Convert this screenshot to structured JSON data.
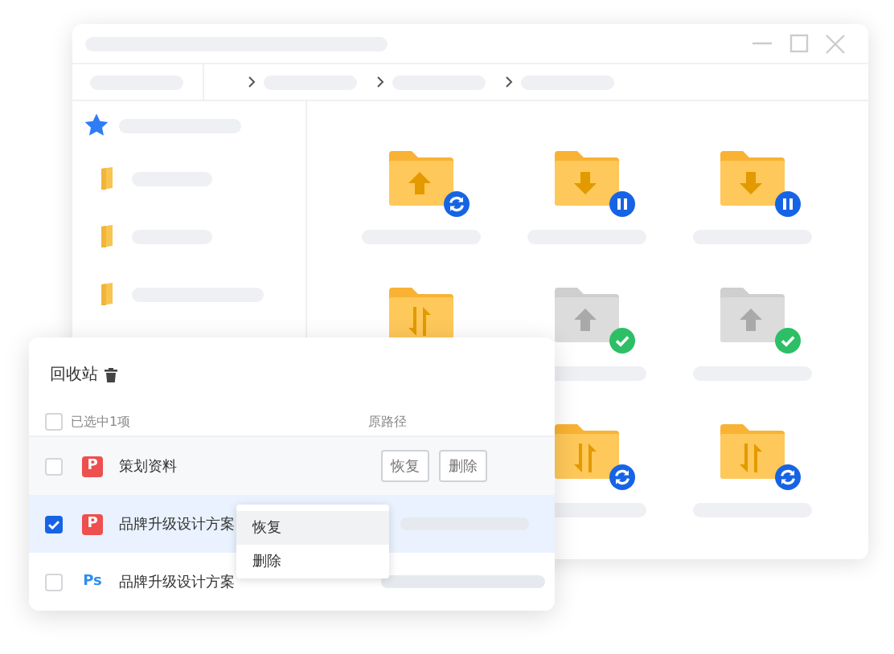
{
  "file_window": {
    "sidebar": {
      "items": [
        {
          "kind": "favorite"
        },
        {
          "kind": "folder"
        },
        {
          "kind": "folder"
        },
        {
          "kind": "folder"
        }
      ]
    },
    "folders": [
      {
        "kind": "upload",
        "badge": {
          "kind": "sync"
        }
      },
      {
        "kind": "download",
        "badge": {
          "kind": "pause"
        }
      },
      {
        "kind": "download",
        "badge": {
          "kind": "pause"
        }
      },
      {
        "kind": "transfer"
      },
      {
        "kind": "upload",
        "badge": {
          "kind": "check"
        }
      },
      {
        "kind": "upload",
        "badge": {
          "kind": "check"
        }
      },
      {
        "kind": "transfer",
        "badge": {
          "kind": "sync"
        }
      },
      {
        "kind": "transfer",
        "badge": {
          "kind": "sync"
        }
      }
    ]
  },
  "recycle_bin": {
    "title": "回收站",
    "header": {
      "checked": false,
      "label": "已选中1项",
      "path_header": "原路径"
    },
    "rows": [
      {
        "kind": "ppt",
        "badge": "P",
        "name": "策划资料",
        "checked": false,
        "selected": false,
        "actions": [
          "恢复",
          "删除"
        ]
      },
      {
        "kind": "ppt",
        "badge": "P",
        "name": "品牌升级设计方案",
        "checked": true,
        "selected": true
      },
      {
        "kind": "psd",
        "badge": "Ps",
        "name": "品牌升级设计方案",
        "checked": false,
        "selected": false
      }
    ],
    "context_menu": {
      "items": [
        {
          "label": "恢复",
          "selected": true
        },
        {
          "label": "删除",
          "selected": false
        }
      ]
    }
  }
}
